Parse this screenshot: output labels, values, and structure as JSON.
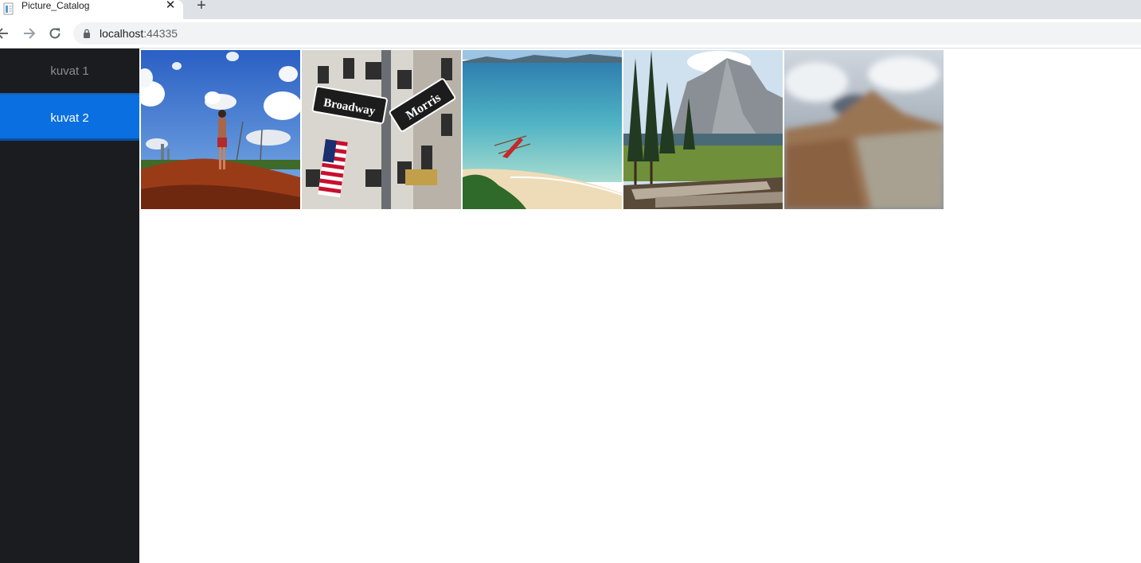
{
  "browser": {
    "tab_title": "Picture_Catalog",
    "tab_close_icon": "close-icon",
    "new_tab_icon": "plus-icon",
    "url_host": "localhost",
    "url_port": ":44335",
    "lock_icon": "lock-icon"
  },
  "sidebar": {
    "items": [
      {
        "label": "kuvat 1",
        "active": false
      },
      {
        "label": "kuvat 2",
        "active": true
      }
    ],
    "active_color": "#0a6fe0",
    "background": "#1a1c20"
  },
  "gallery": {
    "images": [
      {
        "subject": "child-on-dirt-mound-under-cloudy-sky"
      },
      {
        "subject": "broadway-morris-st-street-signs"
      },
      {
        "subject": "red-boat-on-turquoise-beach"
      },
      {
        "subject": "forest-lake-with-granite-mountain"
      },
      {
        "subject": "blurred-desert-landscape"
      }
    ]
  }
}
